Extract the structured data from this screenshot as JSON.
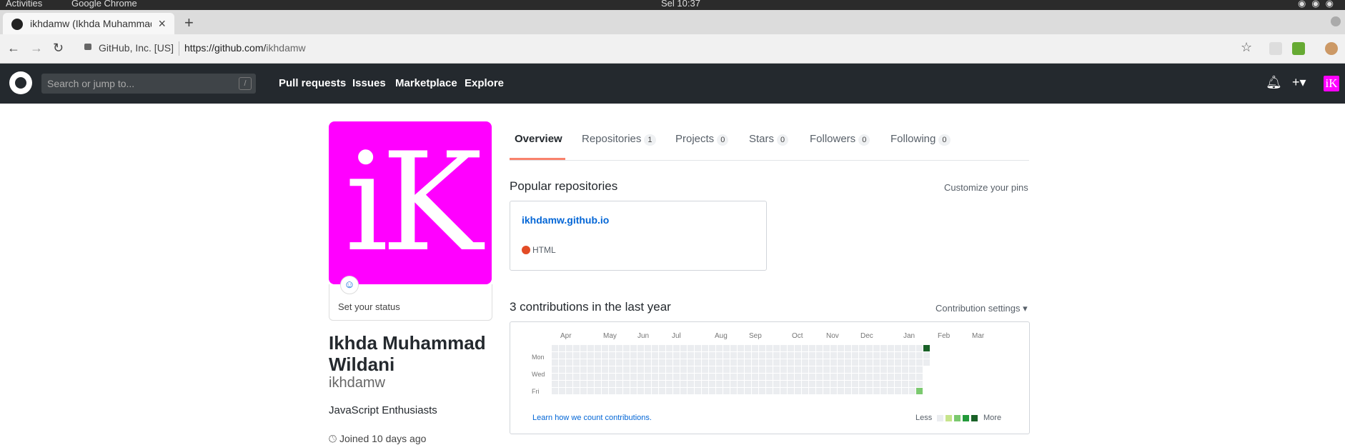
{
  "os_bar": {
    "activities": "Activities",
    "app": "Google Chrome",
    "clock": "Sel 10:37"
  },
  "browser": {
    "tab_title": "ikhdamw (Ikhda Muhammad Wildani)",
    "site_identity": "GitHub, Inc. [US]",
    "url_base": "https://github.com/",
    "url_path": "ikhdamw"
  },
  "header": {
    "search_placeholder": "Search or jump to...",
    "search_shortcut": "/",
    "nav": [
      "Pull requests",
      "Issues",
      "Marketplace",
      "Explore"
    ],
    "avatar_text": "iK"
  },
  "profile": {
    "avatar_text": "iK",
    "avatar_color": "#ff00ff",
    "status": "Set your status",
    "fullname": "Ikhda Muhammad Wildani",
    "login": "ikhdamw",
    "bio": "JavaScript Enthusiasts",
    "joined": "Joined 10 days ago"
  },
  "tabs": [
    {
      "label": "Overview",
      "count": null
    },
    {
      "label": "Repositories",
      "count": "1"
    },
    {
      "label": "Projects",
      "count": "0"
    },
    {
      "label": "Stars",
      "count": "0"
    },
    {
      "label": "Followers",
      "count": "0"
    },
    {
      "label": "Following",
      "count": "0"
    }
  ],
  "popular": {
    "title": "Popular repositories",
    "customize": "Customize your pins",
    "repos": [
      {
        "name": "ikhdamw.github.io",
        "language": "HTML",
        "language_color": "#e34c26"
      }
    ]
  },
  "contributions": {
    "title": "3 contributions in the last year",
    "settings": "Contribution settings",
    "months": [
      "Apr",
      "May",
      "Jun",
      "Jul",
      "Aug",
      "Sep",
      "Oct",
      "Nov",
      "Dec",
      "Jan",
      "Feb",
      "Mar"
    ],
    "days": [
      "Mon",
      "Wed",
      "Fri"
    ],
    "learn": "Learn how we count contributions.",
    "less": "Less",
    "more": "More",
    "colors": [
      "#ebedf0",
      "#c6e48b",
      "#7bc96f",
      "#239a3b",
      "#196127"
    ]
  }
}
